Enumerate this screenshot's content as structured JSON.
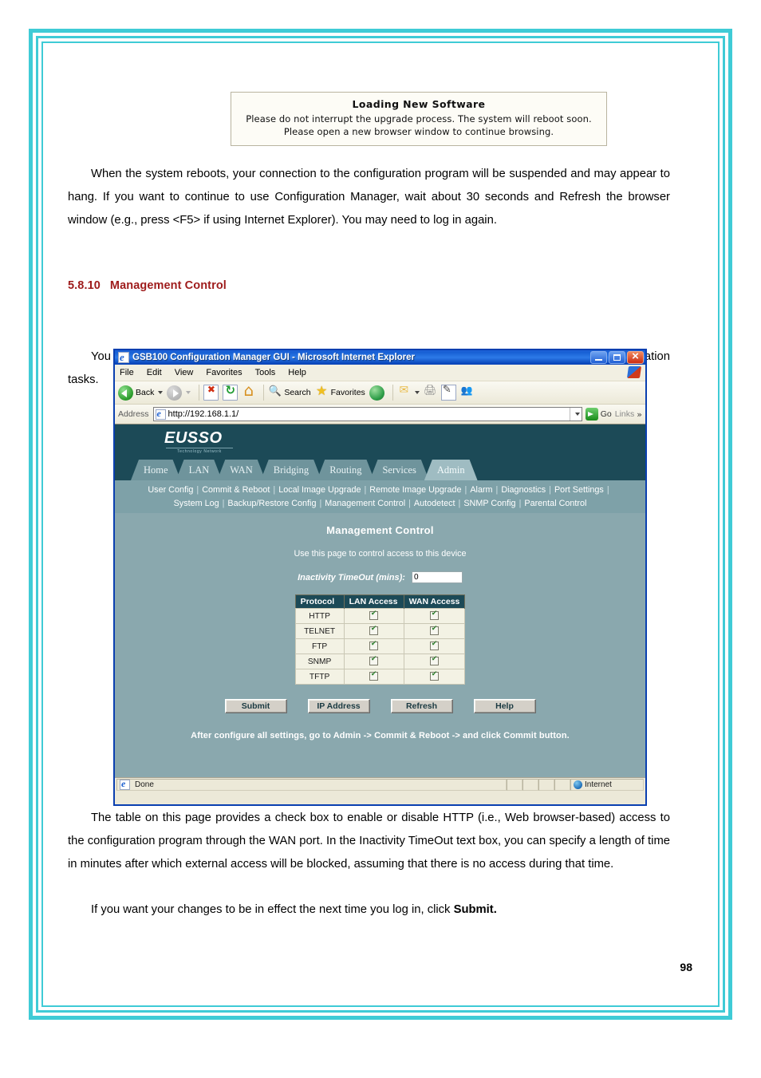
{
  "document": {
    "page_number": "98",
    "notice": {
      "title": "Loading New Software",
      "body": "Please do not interrupt the upgrade process. The system will reboot soon. Please open a new browser window to continue browsing."
    },
    "paragraph_reboot": "When the system reboots, your connection to the configuration program will be suspended and may appear to hang. If you want to continue to use Configuration Manager, wait about 30 seconds and Refresh the browser window (e.g., press <F5> if using Internet Explorer). You may need to log in again.",
    "section": {
      "number": "5.8.10",
      "title": "Management Control"
    },
    "paragraph_enable": "You can enable access to Configuration Manager from the WAN port so that the ISP can perform configuration tasks.",
    "paragraph_table": "The table on this page provides a check box to enable or disable HTTP (i.e., Web browser-based) access to the configuration program through the WAN port. In the Inactivity TimeOut text box, you can specify a length of time in minutes after which external access will be blocked, assuming that there is no access during that time.",
    "paragraph_submit_prefix": "If you want your changes to be in effect the next time you log in, click ",
    "paragraph_submit_bold": "Submit."
  },
  "browser": {
    "title": "GSB100 Configuration Manager GUI - Microsoft Internet Explorer",
    "window_buttons": {
      "minimize": "minimize-button",
      "maximize": "maximize-button",
      "close": "close-button"
    },
    "menu": [
      "File",
      "Edit",
      "View",
      "Favorites",
      "Tools",
      "Help"
    ],
    "toolbar": {
      "back": "Back",
      "forward": "",
      "stop": "stop-icon",
      "refresh": "refresh-icon",
      "home": "home-icon",
      "search": "Search",
      "favorites": "Favorites",
      "history": "history-icon",
      "mail": "mail-icon",
      "print": "print-icon",
      "edit": "edit-icon",
      "messenger": "messenger-icon"
    },
    "address": {
      "label": "Address",
      "url": "http://192.168.1.1/",
      "go": "Go",
      "links": "Links",
      "overflow": "»"
    },
    "status": {
      "message": "Done",
      "zone": "Internet"
    }
  },
  "webpage": {
    "logo": "EUSSO",
    "logo_subtitle": "Technology Network",
    "tabs": [
      {
        "label": "Home",
        "active": false
      },
      {
        "label": "LAN",
        "active": false
      },
      {
        "label": "WAN",
        "active": false
      },
      {
        "label": "Bridging",
        "active": false
      },
      {
        "label": "Routing",
        "active": false
      },
      {
        "label": "Services",
        "active": false
      },
      {
        "label": "Admin",
        "active": true
      }
    ],
    "submenu_row1": [
      "User Config",
      "Commit & Reboot",
      "Local Image Upgrade",
      "Remote Image Upgrade",
      "Alarm",
      "Diagnostics",
      "Port Settings"
    ],
    "submenu_row2": [
      "System Log",
      "Backup/Restore Config",
      "Management Control",
      "Autodetect",
      "SNMP Config",
      "Parental Control"
    ],
    "title": "Management Control",
    "description": "Use this page to control access to this device",
    "timeout_label": "Inactivity TimeOut (mins):",
    "timeout_value": "0",
    "table": {
      "headers": [
        "Protocol",
        "LAN Access",
        "WAN Access"
      ],
      "rows": [
        {
          "protocol": "HTTP",
          "lan": true,
          "wan": true
        },
        {
          "protocol": "TELNET",
          "lan": true,
          "wan": true
        },
        {
          "protocol": "FTP",
          "lan": true,
          "wan": true
        },
        {
          "protocol": "SNMP",
          "lan": true,
          "wan": true
        },
        {
          "protocol": "TFTP",
          "lan": true,
          "wan": true
        }
      ]
    },
    "buttons": [
      "Submit",
      "IP Address",
      "Refresh",
      "Help"
    ],
    "footnote": "After configure all settings, go to Admin -> Commit & Reboot -> and click Commit button.",
    "colors": {
      "header_bg": "#1c4a57",
      "body_bg": "#8aa8ae",
      "submenu_bg": "#7ea1a8",
      "tab_active": "#9fbcc2",
      "frame_accent": "#3fcbd6",
      "section_heading": "#9e1b1b"
    }
  }
}
